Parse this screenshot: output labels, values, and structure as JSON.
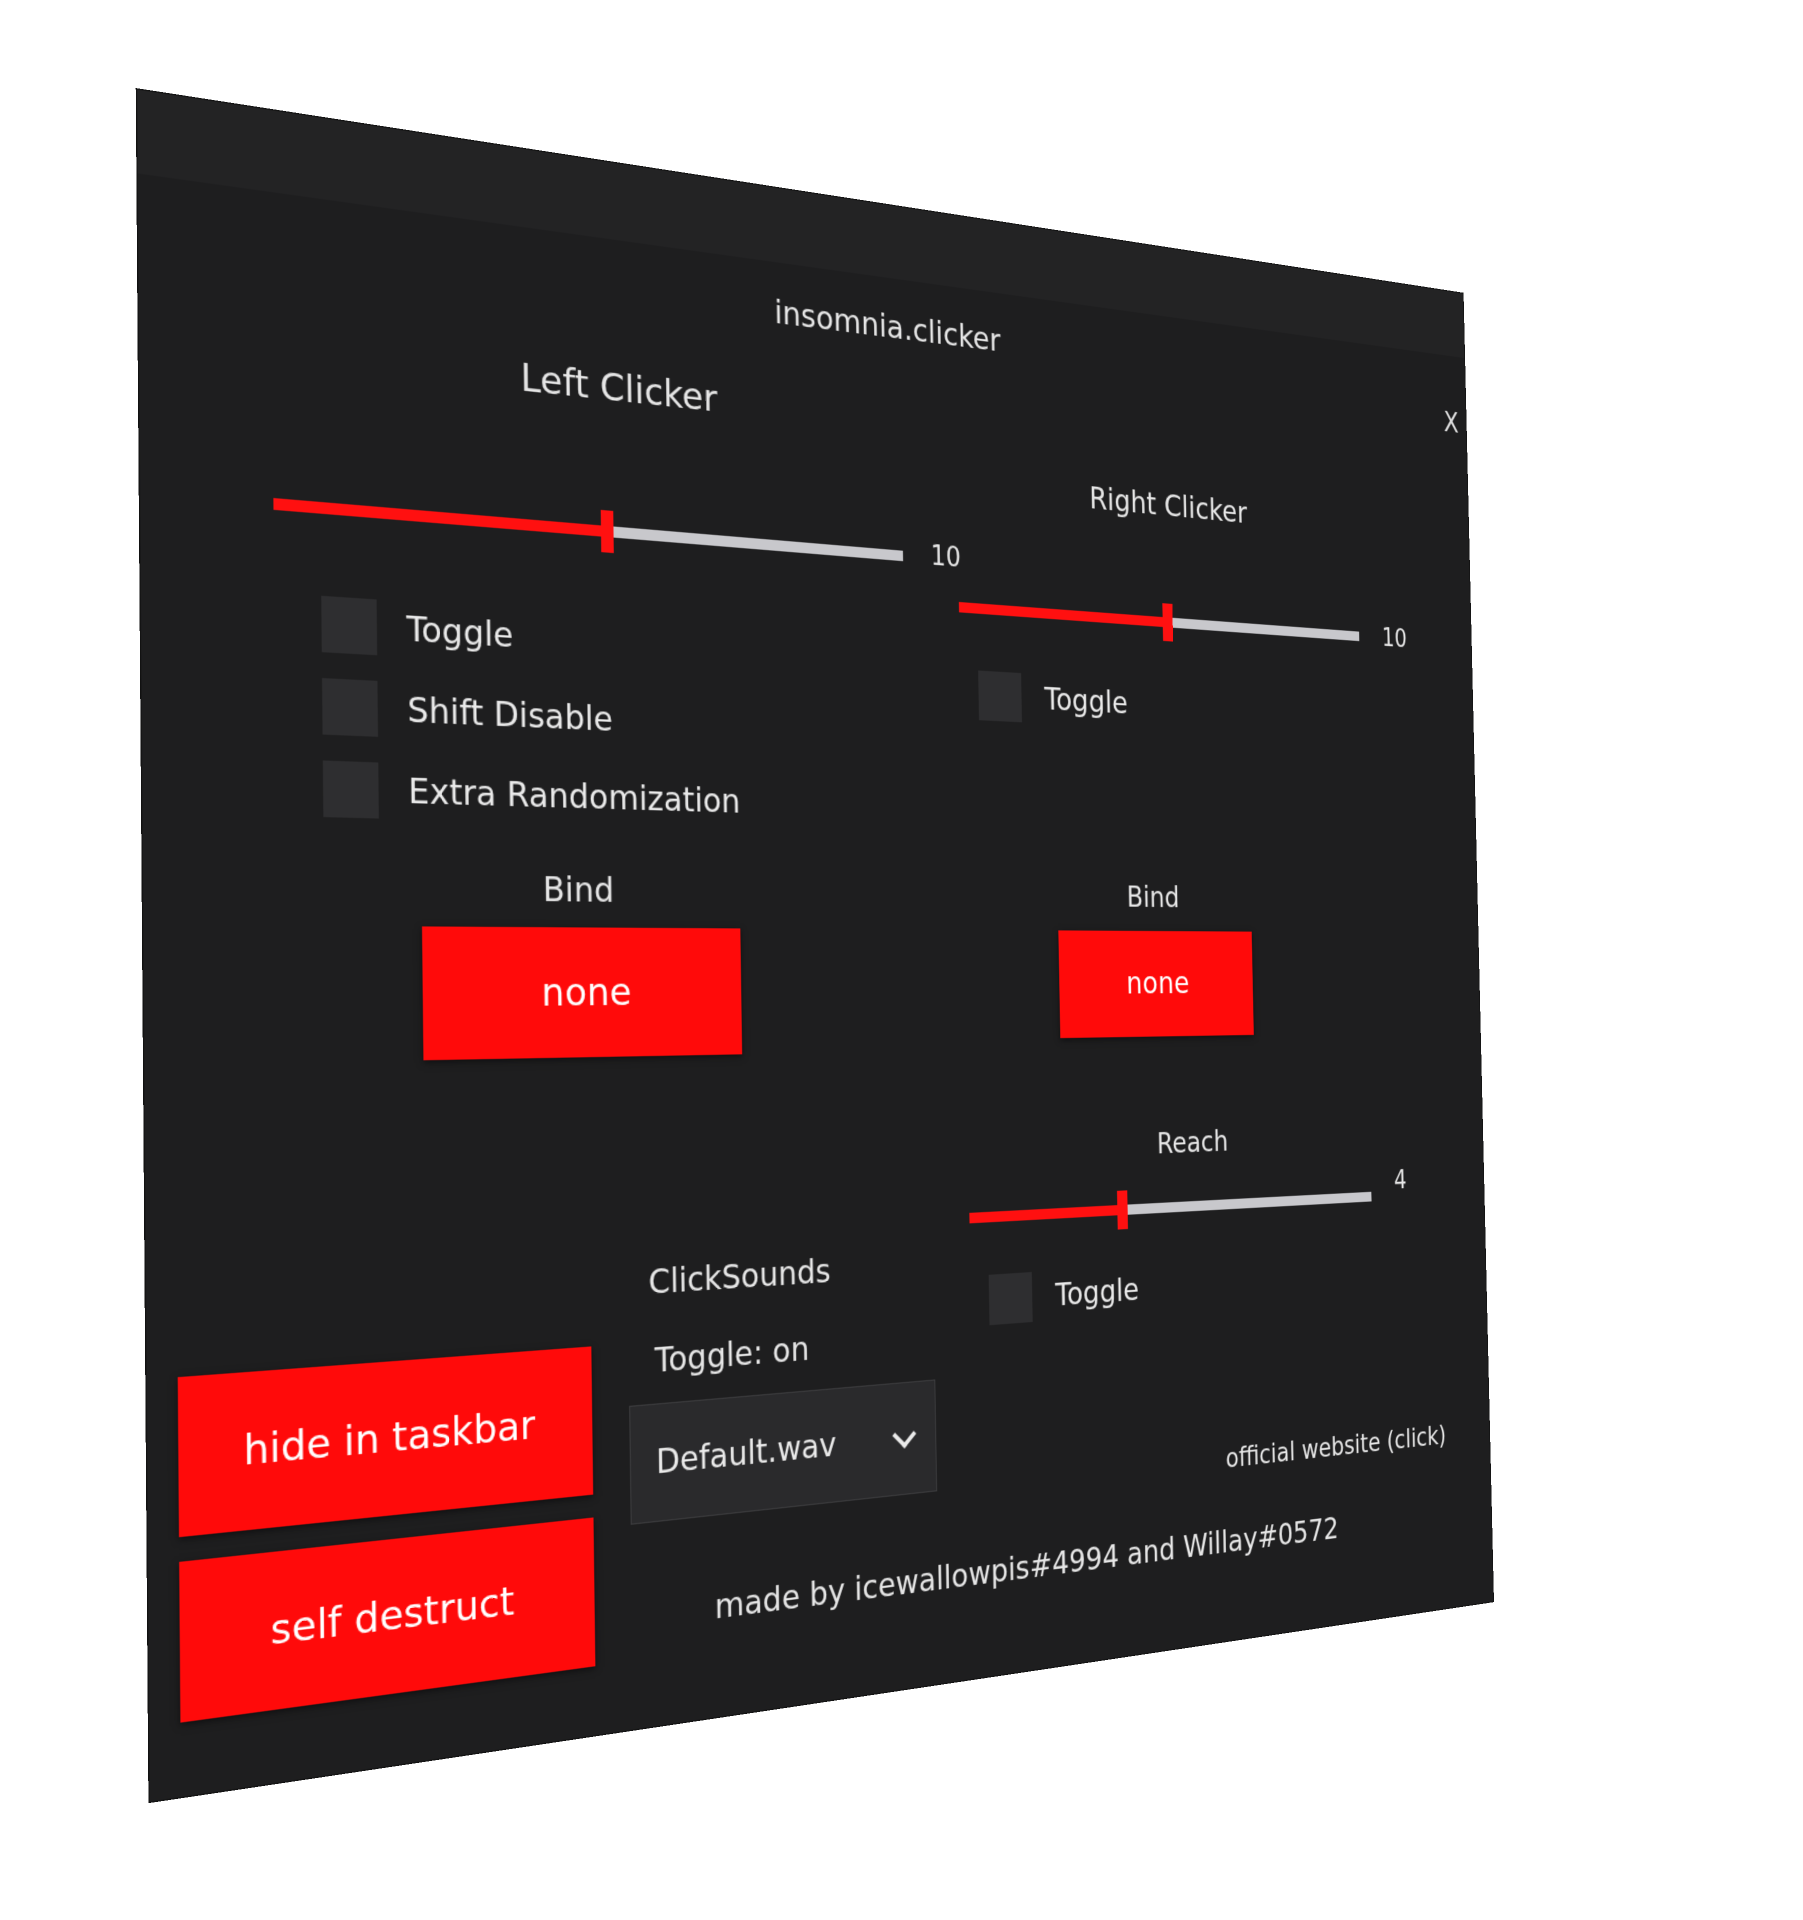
{
  "window": {
    "title": "insomnia.clicker",
    "close_label": "X"
  },
  "left_clicker": {
    "title": "Left Clicker",
    "slider_value": "10",
    "slider_fraction": 0.5,
    "checkboxes": [
      {
        "label": "Toggle",
        "checked": false
      },
      {
        "label": "Shift Disable",
        "checked": false
      },
      {
        "label": "Extra Randomization",
        "checked": false
      }
    ],
    "bind_label": "Bind",
    "bind_button": "none"
  },
  "right_clicker": {
    "title": "Right Clicker",
    "slider_value": "10",
    "slider_fraction": 0.5,
    "toggle_label": "Toggle",
    "bind_label": "Bind",
    "bind_button": "none"
  },
  "reach": {
    "title": "Reach",
    "slider_value": "4",
    "slider_fraction": 0.36,
    "toggle_label": "Toggle"
  },
  "click_sounds": {
    "title": "ClickSounds",
    "toggle_text": "Toggle: on",
    "selected_sound": "Default.wav"
  },
  "actions": {
    "hide_label": "hide in taskbar",
    "destruct_label": "self destruct"
  },
  "footer": {
    "credits": "made by icewallowpis#4994 and Willay#0572",
    "website_link": "official website (click)"
  },
  "colors": {
    "accent": "#ff0a0a",
    "background": "#1e1e1f",
    "track": "#c8c8cc"
  }
}
